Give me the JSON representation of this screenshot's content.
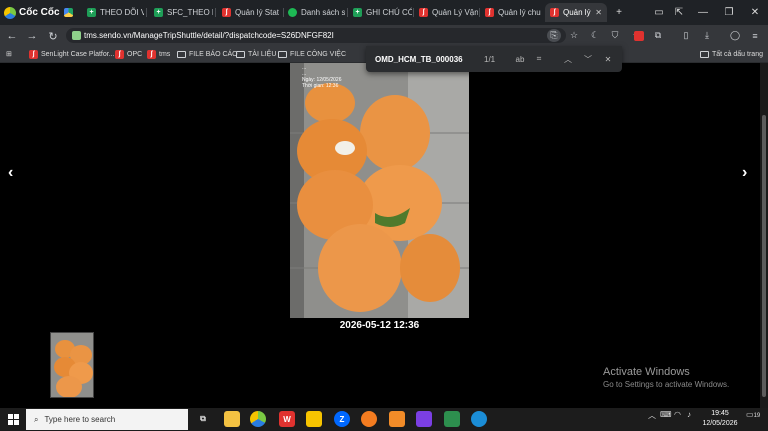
{
  "browser": {
    "brand": "Cốc Cốc",
    "tabs": [
      {
        "label": "THEO DÕI V",
        "favicon": "drive-icon"
      },
      {
        "label": "THEO DÕI V",
        "favicon": "sheets-icon"
      },
      {
        "label": "SFC_THEO D",
        "favicon": "sheets-icon"
      },
      {
        "label": "Quản lý Stat",
        "favicon": "sendo-icon"
      },
      {
        "label": "Danh sách s",
        "favicon": "green-circle-icon"
      },
      {
        "label": "GHI CHÚ CÓ",
        "favicon": "sheets-icon"
      },
      {
        "label": "Quản Lý Vận",
        "favicon": "sendo-icon"
      },
      {
        "label": "Quản lý chu",
        "favicon": "sendo-icon"
      },
      {
        "label": "Quản lý",
        "favicon": "sendo-icon",
        "active": true
      }
    ],
    "new_tab": "+",
    "window_controls": {
      "minimize": "—",
      "maximize": "❐",
      "close": "✕"
    },
    "url": "tms.sendo.vn/ManageTripShuttle/detail/?dispatchcode=S26DNFGF82I",
    "bookmarks": [
      {
        "label": "SenLight Case Platfor...",
        "type": "site"
      },
      {
        "label": "OPC",
        "type": "site"
      },
      {
        "label": "tms",
        "type": "site"
      },
      {
        "label": "FILE BÁO CÁO",
        "type": "folder"
      },
      {
        "label": "TÀI LIỆU",
        "type": "folder"
      },
      {
        "label": "FILE CÔNG VIỆC",
        "type": "folder"
      }
    ],
    "all_bookmarks": "Tất cả dấu trang",
    "find": {
      "query": "OMD_HCM_TB_000036",
      "count": "1/1",
      "match_case": "ab"
    }
  },
  "viewer": {
    "prev": "‹",
    "next": "›",
    "caption": "2026-05-12 12:36",
    "photo_overlay": [
      "...",
      "...",
      "Ngày: 12/05/2026",
      "Thời gian: 12:36"
    ]
  },
  "activation": {
    "title": "Activate Windows",
    "subtitle": "Go to Settings to activate Windows."
  },
  "taskbar": {
    "search_placeholder": "Type here to search",
    "time": "19:45",
    "date": "12/05/2026",
    "notification_count": "19"
  }
}
